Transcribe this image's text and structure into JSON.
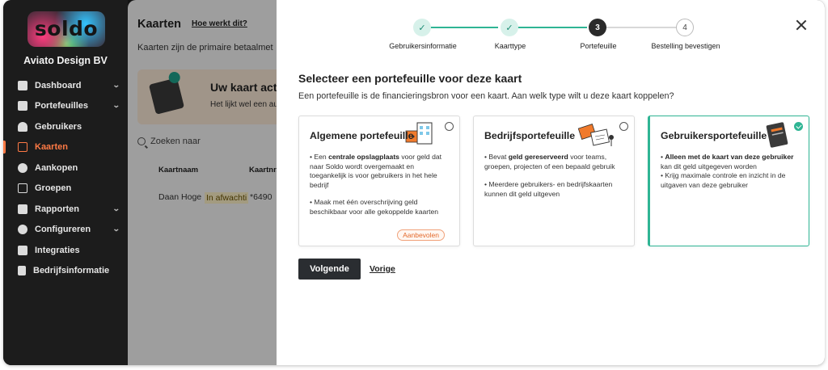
{
  "sidebar": {
    "logo_text": "soldo",
    "company": "Aviato Design BV",
    "items": [
      {
        "label": "Dashboard",
        "icon": "home-icon",
        "has_chevron": true
      },
      {
        "label": "Portefeuilles",
        "icon": "wallet-icon",
        "has_chevron": true
      },
      {
        "label": "Gebruikers",
        "icon": "user-icon",
        "has_chevron": false
      },
      {
        "label": "Kaarten",
        "icon": "card-icon",
        "has_chevron": false,
        "active": true
      },
      {
        "label": "Aankopen",
        "icon": "purchases-icon",
        "has_chevron": false
      },
      {
        "label": "Groepen",
        "icon": "groups-icon",
        "has_chevron": false
      },
      {
        "label": "Rapporten",
        "icon": "chart-icon",
        "has_chevron": true
      },
      {
        "label": "Configureren",
        "icon": "gear-icon",
        "has_chevron": true
      },
      {
        "label": "Integraties",
        "icon": "puzzle-icon",
        "has_chevron": false
      },
      {
        "label": "Bedrijfsinformatie",
        "icon": "building-icon",
        "has_chevron": false
      }
    ]
  },
  "background_page": {
    "title": "Kaarten",
    "help_link": "Hoe werkt dit?",
    "subtitle": "Kaarten zijn de primaire betaalmet",
    "banner_title": "Uw kaart activer",
    "banner_text": "Het lijkt wel een auto",
    "search_placeholder": "Zoeken naar",
    "columns": [
      "Kaartnaam",
      "Kaartnr."
    ],
    "row": {
      "name": "Daan Hoge",
      "status": "In afwachti",
      "number": "*6490"
    }
  },
  "stepper": {
    "steps": [
      {
        "label": "Gebruikersinformatie",
        "state": "done",
        "marker": "✓"
      },
      {
        "label": "Kaarttype",
        "state": "done",
        "marker": "✓"
      },
      {
        "label": "Portefeuille",
        "state": "current",
        "marker": "3"
      },
      {
        "label": "Bestelling bevestigen",
        "state": "todo",
        "marker": "4"
      }
    ],
    "accent": "#2fb594"
  },
  "modal": {
    "heading": "Selecteer een portefeuille voor deze kaart",
    "description": "Een portefeuille is de financieringsbron voor een kaart. Aan welk type wilt u deze kaart koppelen?",
    "next_label": "Volgende",
    "prev_label": "Vorige"
  },
  "wallet_options": [
    {
      "title": "Algemene portefeuille",
      "selected": false,
      "bullet1_pre": "• Een ",
      "bullet1_bold": "centrale opslagplaats",
      "bullet1_post": " voor geld dat naar Soldo wordt overgemaakt en toegankelijk is voor gebruikers in het hele bedrijf",
      "bullet2": "• Maak met één overschrijving geld beschikbaar voor alle gekoppelde kaarten",
      "badge": "Aanbevolen"
    },
    {
      "title": "Bedrijfsportefeuille",
      "selected": false,
      "bullet1_pre": "• Bevat ",
      "bullet1_bold": "geld gereserveerd",
      "bullet1_post": " voor teams, groepen, projecten of een bepaald gebruik",
      "bullet2": "• Meerdere gebruikers- en bedrijfskaarten kunnen dit geld uitgeven"
    },
    {
      "title": "Gebruikersportefeuille",
      "selected": true,
      "bullet1_pre": "• ",
      "bullet1_bold": "Alleen met de kaart van deze gebruiker",
      "bullet1_post": " kan dit geld uitgegeven worden",
      "bullet2": "• Krijg maximale controle en inzicht in de uitgaven van deze gebruiker"
    }
  ],
  "colors": {
    "accent_orange": "#ff7a45",
    "accent_green": "#2fb594",
    "dark_button": "#2a2d31"
  }
}
